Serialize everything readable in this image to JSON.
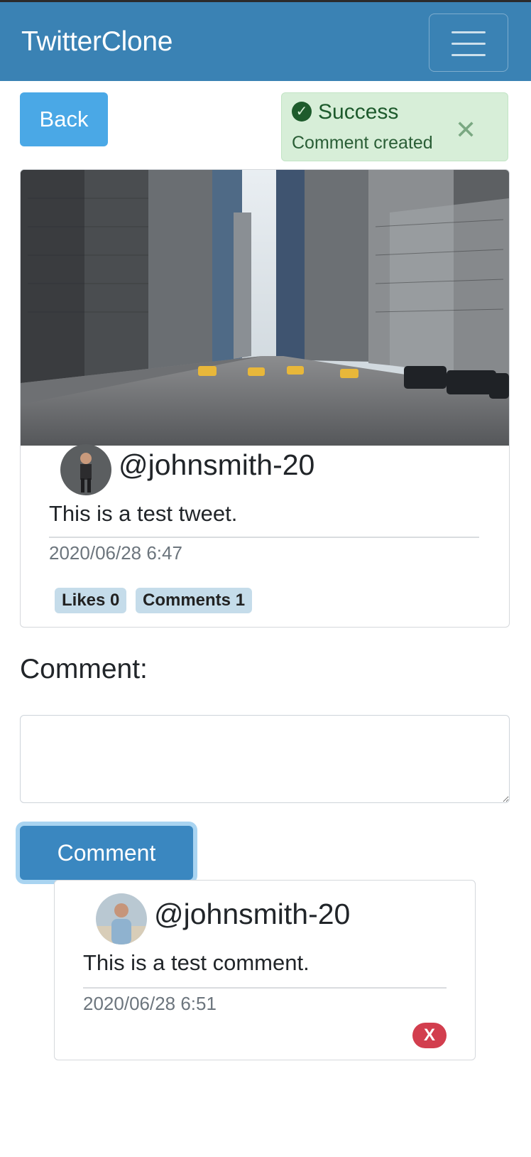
{
  "navbar": {
    "brand": "TwitterClone",
    "menu_icon": "hamburger-menu-icon"
  },
  "back_button": {
    "label": "Back"
  },
  "alert": {
    "icon": "check-circle-icon",
    "title": "Success",
    "message": "Comment created",
    "close_icon": "close-icon",
    "color": "#d7eed8"
  },
  "tweet": {
    "image": "city-street-photo",
    "handle": "@johnsmith-20",
    "text": "This is a test tweet.",
    "timestamp": "2020/06/28 6:47",
    "likes_label": "Likes 0",
    "comments_label": "Comments 1"
  },
  "comment_form": {
    "label": "Comment:",
    "value": "",
    "submit_label": "Comment"
  },
  "comments": [
    {
      "handle": "@johnsmith-20",
      "text": "This is a test comment.",
      "timestamp": "2020/06/28 6:51",
      "delete_label": "X"
    }
  ],
  "colors": {
    "navbar": "#3a82b4",
    "primary_button": "#4aa8e6",
    "danger": "#d23e4e"
  }
}
